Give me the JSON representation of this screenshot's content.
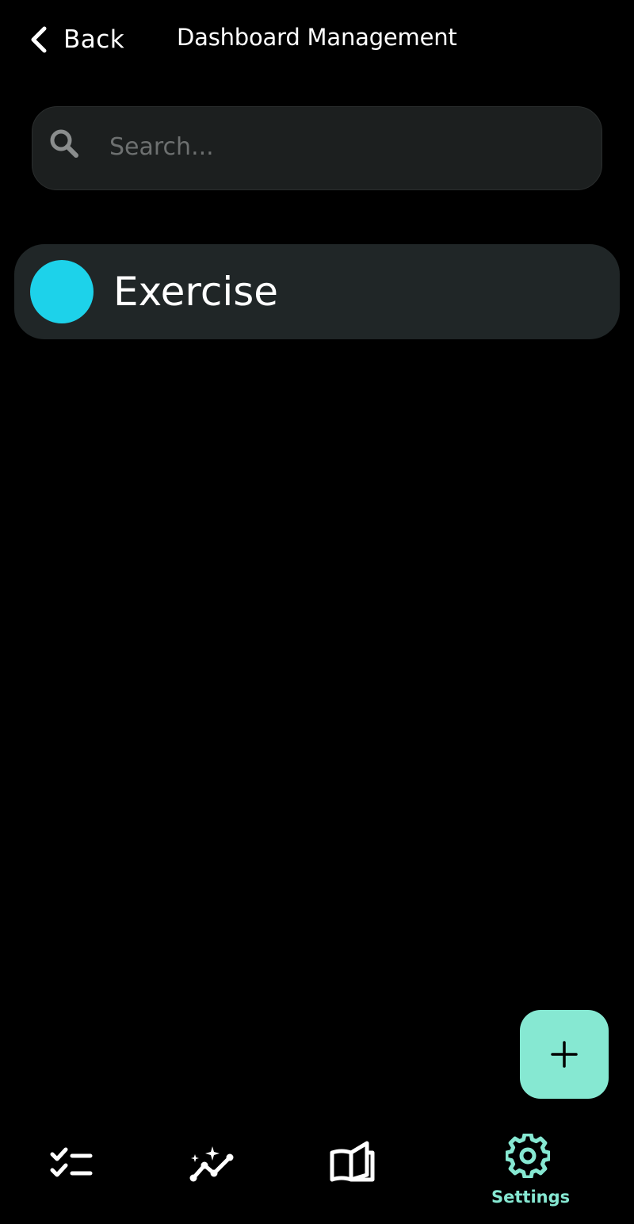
{
  "header": {
    "back_label": "Back",
    "title": "Dashboard Management"
  },
  "search": {
    "placeholder": "Search...",
    "value": ""
  },
  "list": {
    "items": [
      {
        "label": "Exercise",
        "color": "#1dd2ea"
      }
    ]
  },
  "fab": {
    "icon": "plus-icon",
    "color": "#86e8d2"
  },
  "bottom_nav": {
    "items": [
      {
        "icon": "checklist-icon",
        "label": ""
      },
      {
        "icon": "trend-sparkle-icon",
        "label": ""
      },
      {
        "icon": "open-book-icon",
        "label": ""
      },
      {
        "icon": "gear-icon",
        "label": "Settings",
        "active": true
      }
    ],
    "active_color": "#86e8d2"
  }
}
